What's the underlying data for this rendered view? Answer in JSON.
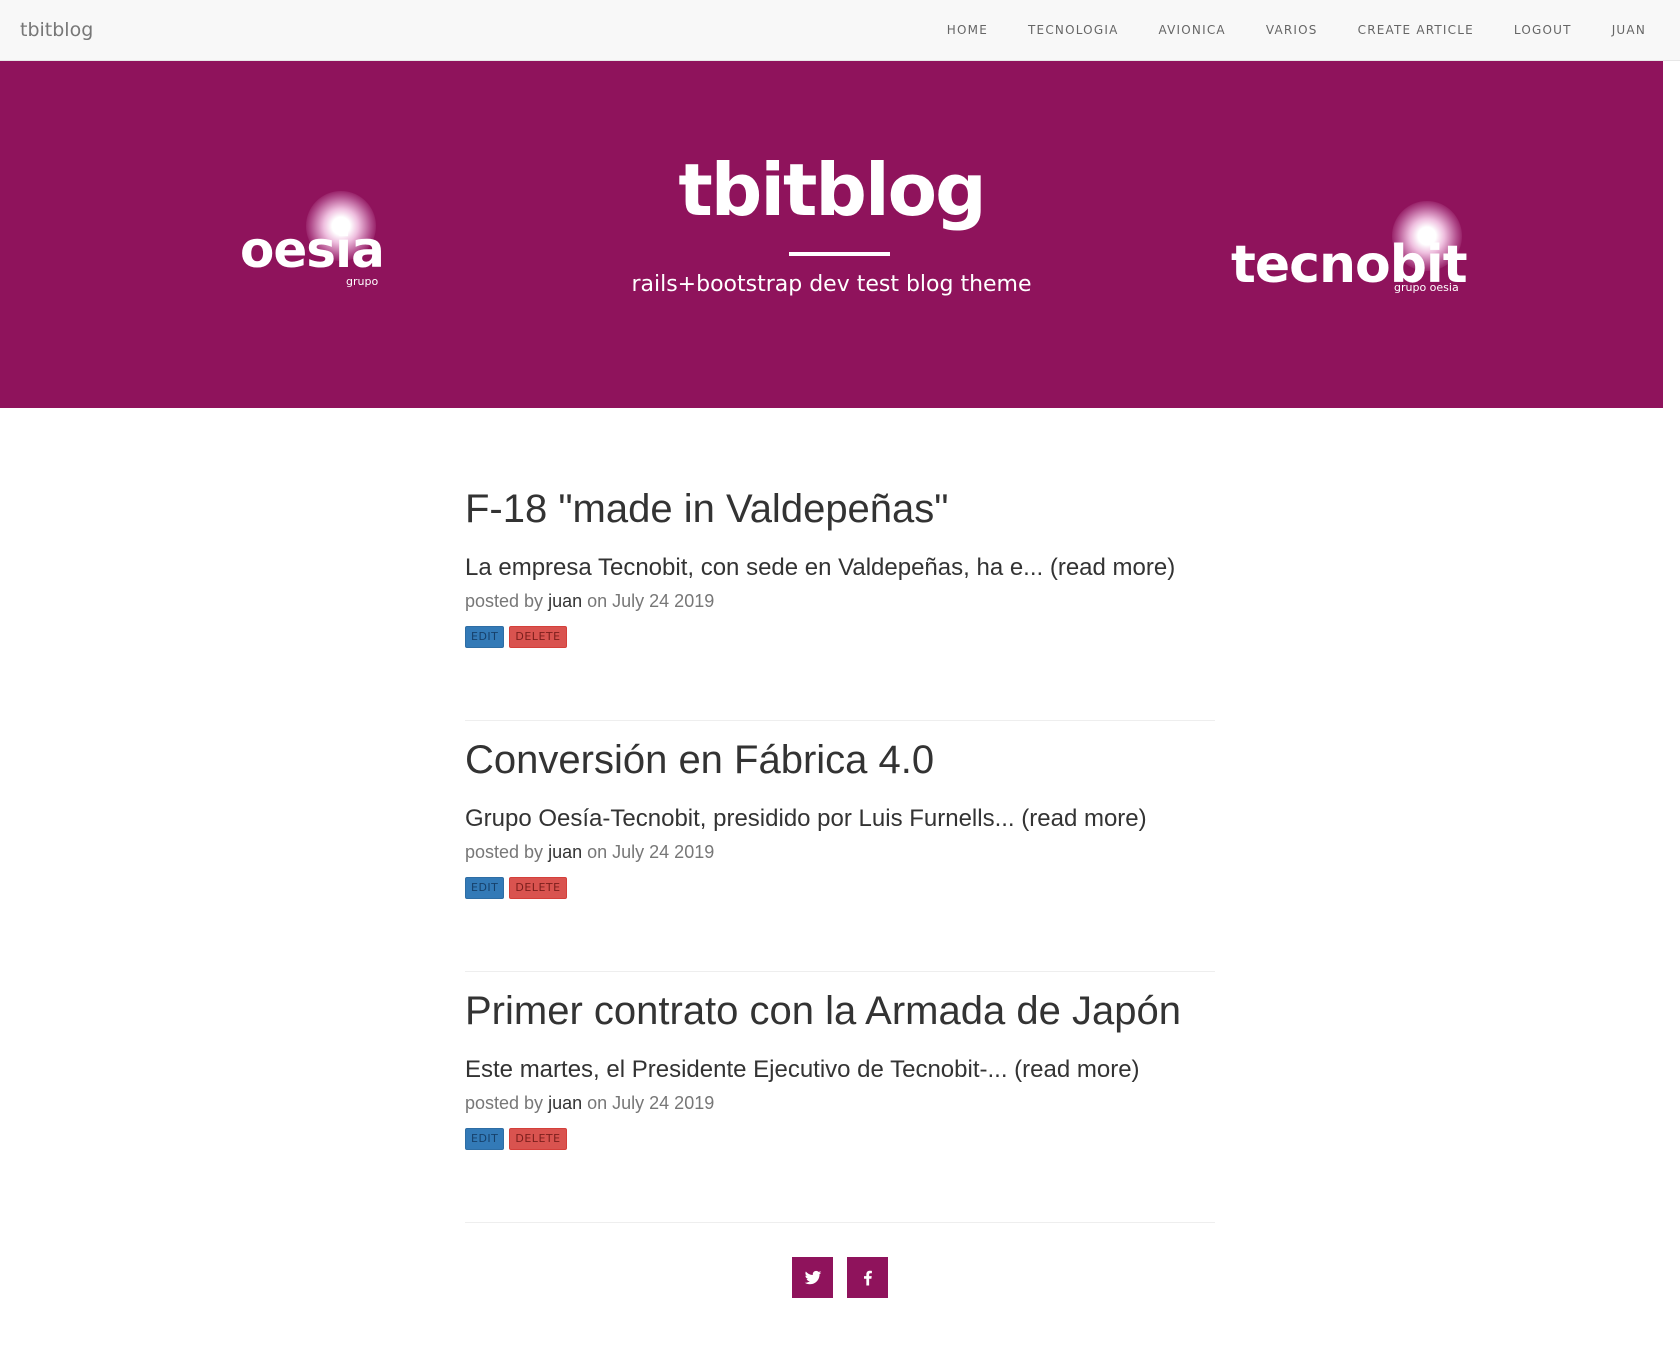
{
  "navbar": {
    "brand": "tbitblog",
    "links": [
      "HOME",
      "TECNOLOGIA",
      "AVIONICA",
      "VARIOS",
      "CREATE ARTICLE",
      "LOGOUT",
      "JUAN"
    ]
  },
  "hero": {
    "title": "tbitblog",
    "subtitle": "rails+bootstrap dev test blog theme",
    "background_color": "#8f135c",
    "logo_left": {
      "word": "oesia",
      "sub": "grupo"
    },
    "logo_right": {
      "word": "tecnobit",
      "sub": "grupo oesia"
    }
  },
  "posts": [
    {
      "title": "F-18 \"made in Valdepeñas\"",
      "excerpt": "La empresa Tecnobit, con sede en Valdepeñas, ha e... (read more)",
      "posted_by_label": "posted by",
      "author": "juan",
      "date_text": "on July 24 2019",
      "edit_label": "EDIT",
      "delete_label": "DELETE"
    },
    {
      "title": "Conversión en Fábrica 4.0",
      "excerpt": "Grupo Oesía-Tecnobit, presidido por Luis Furnells... (read more)",
      "posted_by_label": "posted by",
      "author": "juan",
      "date_text": "on July 24 2019",
      "edit_label": "EDIT",
      "delete_label": "DELETE"
    },
    {
      "title": "Primer contrato con la Armada de Japón",
      "excerpt": "Este martes, el Presidente Ejecutivo de Tecnobit-... (read more)",
      "posted_by_label": "posted by",
      "author": "juan",
      "date_text": "on July 24 2019",
      "edit_label": "EDIT",
      "delete_label": "DELETE"
    }
  ],
  "footer": {
    "social_icons": [
      "twitter-icon",
      "facebook-icon"
    ]
  }
}
